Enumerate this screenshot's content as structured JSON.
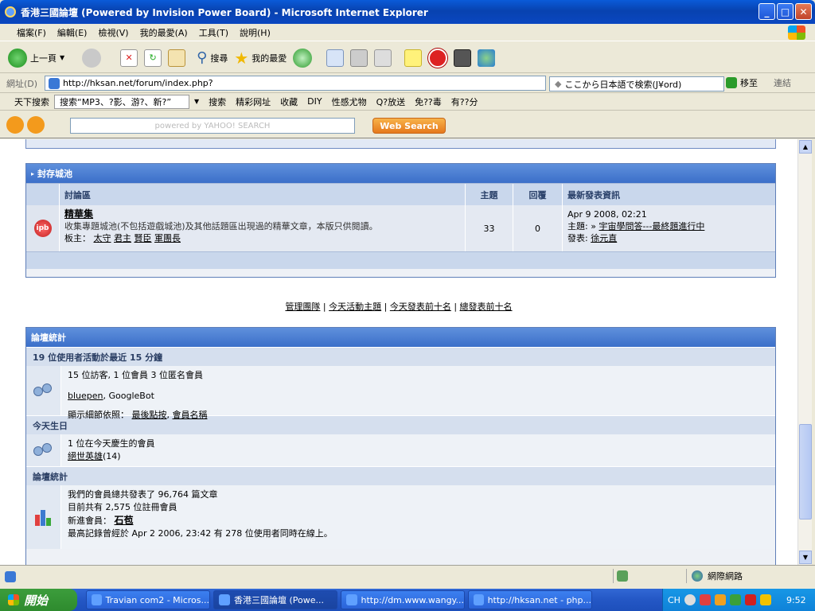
{
  "window": {
    "title": "香港三國論壇 (Powered by Invision Power Board) - Microsoft Internet Explorer"
  },
  "menu": [
    "檔案(F)",
    "編輯(E)",
    "檢視(V)",
    "我的最愛(A)",
    "工具(T)",
    "說明(H)"
  ],
  "toolbar": {
    "back_label": "上一頁",
    "search_label": "搜尋",
    "favorites_label": "我的最愛"
  },
  "address": {
    "label": "網址(D)",
    "url": "http://hksan.net/forum/index.php?",
    "jp_search": "ここから日本語で検索(J¥ord)",
    "go_label": "移至",
    "links_label": "連結"
  },
  "links_toolbar": [
    "天下搜索",
    "搜索“MP3、?影、游?、新?”",
    "搜索",
    "精彩网址",
    "收藏",
    "DIY",
    "性感尤物",
    "Q?放送",
    "免??毒",
    "有??分"
  ],
  "yahoo": {
    "search_placeholder": "powered by YAHOO! SEARCH",
    "web_search_label": "Web Search"
  },
  "archived": {
    "header": "封存城池",
    "col_forum": "討論區",
    "col_topics": "主題",
    "col_replies": "回覆",
    "col_last": "最新發表資訊",
    "forum": {
      "name": "精華集",
      "desc": "收集專題城池(不包括遊戲城池)及其他話題區出現過的精華文章，本版只供閱讀。",
      "mods_label": "板主：",
      "mods": [
        "太守",
        "君主",
        "賢臣",
        "軍團長"
      ],
      "topics": "33",
      "replies": "0",
      "last_date": "Apr 9 2008, 02:21",
      "last_topic_label": "主題:",
      "last_topic": "宇宙學問答---最終題進行中",
      "last_poster_label": "發表:",
      "last_poster": "徐元直"
    }
  },
  "center_links": [
    "管理團隊",
    "今天活動主題",
    "今天發表前十名",
    "總發表前十名"
  ],
  "stats": {
    "header": "論壇統計",
    "active_title": "19 位使用者活動於最近 15 分鐘",
    "active_line1": "15 位訪客, 1 位會員 3 位匿名會員",
    "active_users": [
      "bluepen",
      "GoogleBot"
    ],
    "sort_label": "顯示細節依照：",
    "sort_options": [
      "最後點按",
      "會員名稱"
    ],
    "birthday_title": "今天生日",
    "birthday_line": "1 位在今天慶生的會員",
    "birthday_user": "絕世英雄",
    "birthday_age": "(14)",
    "board_title": "論壇統計",
    "board_line1": "我們的會員總共發表了 96,764 篇文章",
    "board_line2": "目前共有 2,575 位註冊會員",
    "newest_label": "新進會員：",
    "newest_member": "石苞",
    "board_line4": "最高記錄曾經於 Apr 2 2006, 23:42 有 278 位使用者同時在線上。"
  },
  "statusbar": {
    "zone": "網際網路"
  },
  "taskbar": {
    "start_label": "開始",
    "tasks": [
      "Travian com2 - Micros...",
      "香港三國論壇 (Powe...",
      "http://dm.www.wangy...",
      "http://hksan.net - php..."
    ],
    "lang": "CH",
    "clock": "9:52"
  }
}
